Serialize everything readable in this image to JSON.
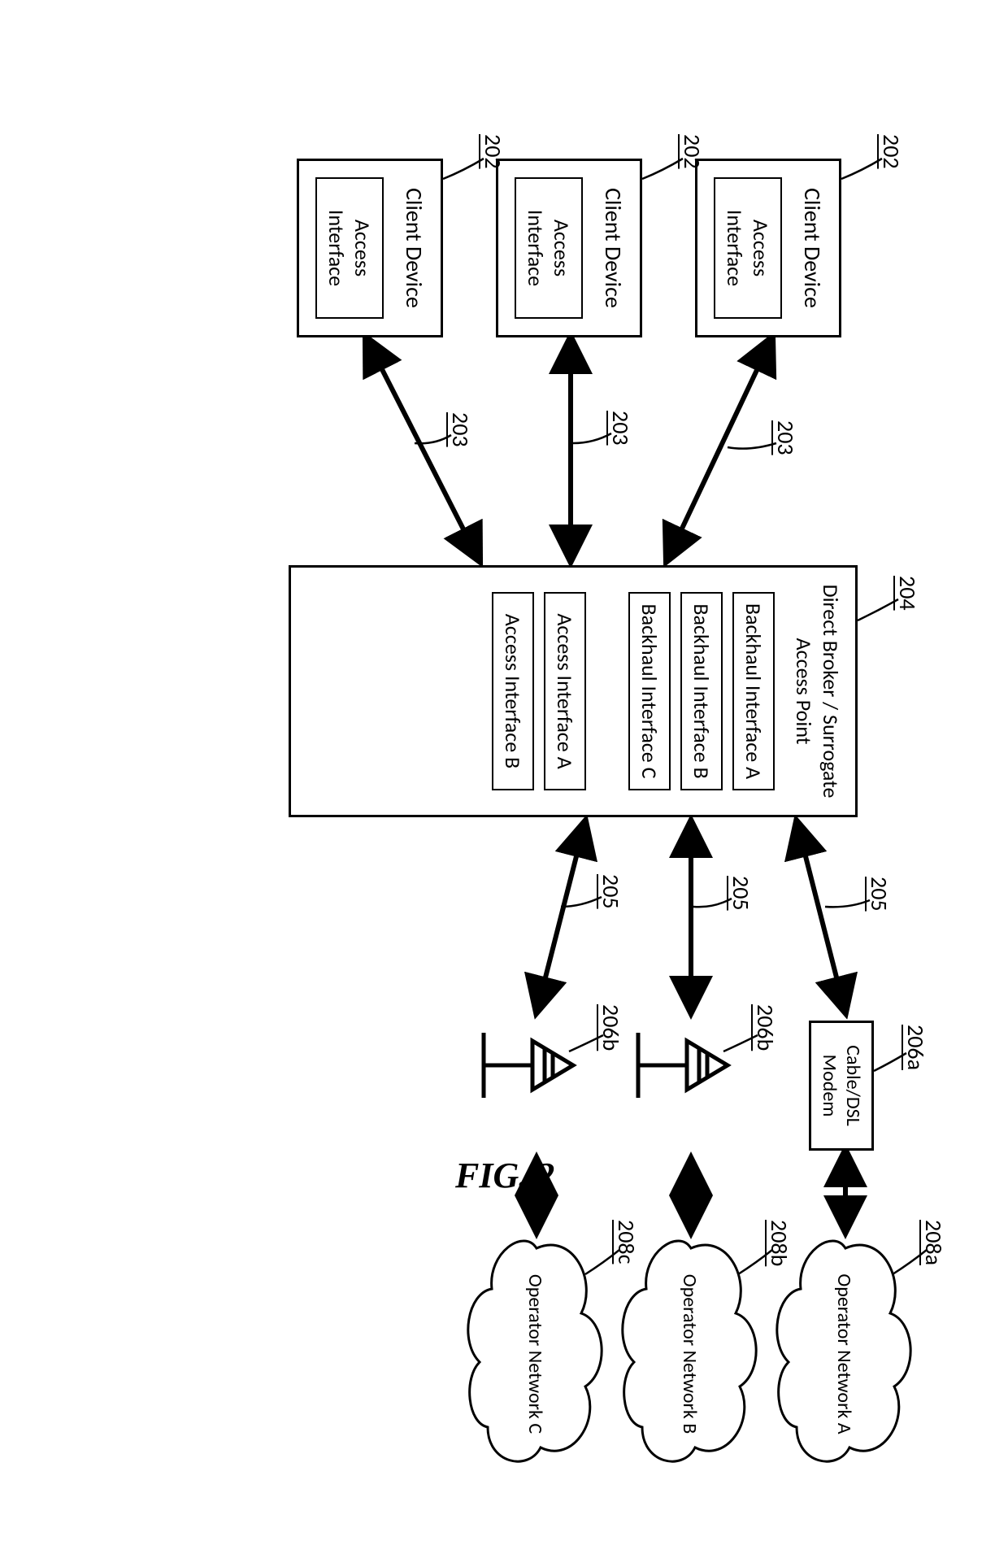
{
  "figure_label": "FIG. 2",
  "refs": {
    "client": "202",
    "access_link": "203",
    "broker": "204",
    "backhaul_link": "205",
    "modem": "206a",
    "tower": "206b",
    "netA": "208a",
    "netB": "208b",
    "netC": "208c"
  },
  "client": {
    "title": "Client Device",
    "sub": "Access Interface"
  },
  "broker": {
    "title": "Direct Broker / Surrogate Access Point",
    "bh_a": "Backhaul Interface A",
    "bh_b": "Backhaul Interface B",
    "bh_c": "Backhaul Interface C",
    "ac_a": "Access Interface A",
    "ac_b": "Access Interface B"
  },
  "modem": {
    "line1": "Cable/DSL",
    "line2": "Modem"
  },
  "networks": {
    "a": "Operator Network A",
    "b": "Operator Network B",
    "c": "Operator Network C"
  }
}
